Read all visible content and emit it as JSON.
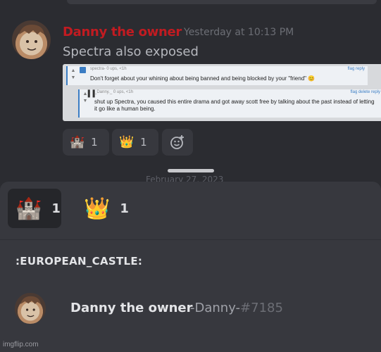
{
  "message": {
    "username": "Danny the owner",
    "timestamp": "Yesterday at 10:13 PM",
    "text": "Spectra also exposed",
    "colors": {
      "username": "#c21b21"
    }
  },
  "embed": {
    "post1": {
      "meta": "spectra-   0 ups, <1h",
      "links": "flag reply",
      "body": "Don't forget about your whining about being banned and being blocked by your \"friend\" 😊"
    },
    "post2": {
      "meta": "_Danny._   0 ups, <1h",
      "links": "flag delete reply",
      "body": "shut up Spectra, you caused this entire drama and got away scott free by talking about the past instead of letting it go like a human being."
    }
  },
  "reactions": [
    {
      "emoji": "🏰",
      "icon": "european-castle-emoji",
      "count": "1"
    },
    {
      "emoji": "👑",
      "icon": "crown-emoji",
      "count": "1"
    }
  ],
  "add_reaction_icon": "add-reaction-icon",
  "sheet": {
    "peek_text": "February 27, 2023",
    "tabs": [
      {
        "emoji": "🏰",
        "count": "1",
        "active": true
      },
      {
        "emoji": "👑",
        "count": "1",
        "active": false
      }
    ],
    "emoji_name": ":EUROPEAN_CASTLE:",
    "users": [
      {
        "display_name": "Danny the owner",
        "username": "-Danny-",
        "discriminator": "#7185"
      }
    ]
  },
  "watermark": "imgflip.com"
}
